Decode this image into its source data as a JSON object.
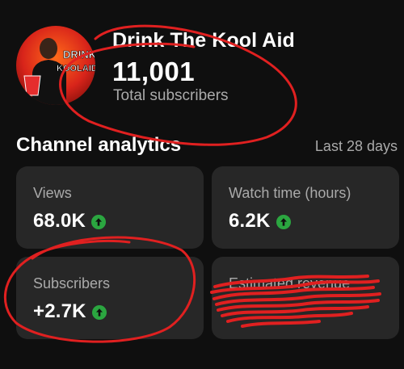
{
  "channel": {
    "name": "Drink The Kool Aid",
    "subscriber_count": "11,001",
    "subscriber_label": "Total subscribers",
    "avatar_text_top": "DRINK",
    "avatar_text_bottom": "KOOLAID"
  },
  "analytics": {
    "title": "Channel analytics",
    "period": "Last 28 days",
    "cards": [
      {
        "label": "Views",
        "value": "68.0K",
        "trend_icon": "arrow-up-circle-icon"
      },
      {
        "label": "Watch time (hours)",
        "value": "6.2K",
        "trend_icon": "arrow-up-circle-icon"
      },
      {
        "label": "Subscribers",
        "value": "+2.7K",
        "trend_icon": "arrow-up-circle-icon"
      },
      {
        "label": "Estimated revenue",
        "value": ""
      }
    ]
  },
  "colors": {
    "background": "#0f0f0f",
    "card": "#272727",
    "trend_up": "#2ba640",
    "annotation": "#e02020"
  }
}
